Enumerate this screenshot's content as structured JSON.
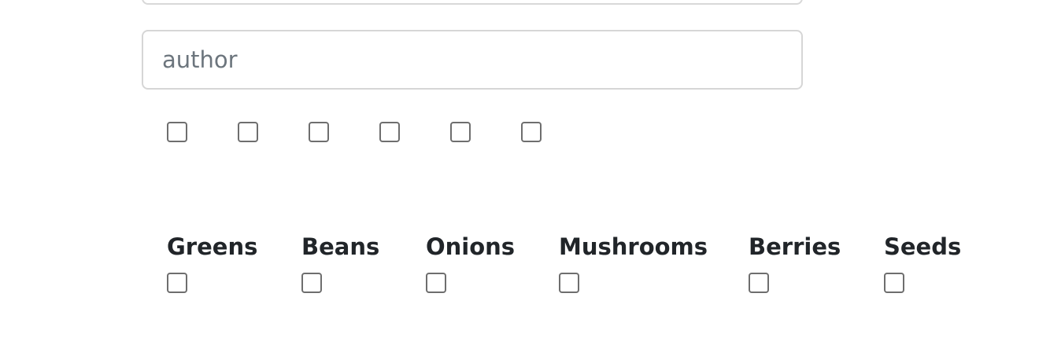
{
  "author_input": {
    "placeholder": "author",
    "value": ""
  },
  "unlabeled_checkboxes": [
    {
      "checked": false
    },
    {
      "checked": false
    },
    {
      "checked": false
    },
    {
      "checked": false
    },
    {
      "checked": false
    },
    {
      "checked": false
    }
  ],
  "food_options": [
    {
      "label": "Greens",
      "checked": false
    },
    {
      "label": "Beans",
      "checked": false
    },
    {
      "label": "Onions",
      "checked": false
    },
    {
      "label": "Mushrooms",
      "checked": false
    },
    {
      "label": "Berries",
      "checked": false
    },
    {
      "label": "Seeds",
      "checked": false
    }
  ]
}
